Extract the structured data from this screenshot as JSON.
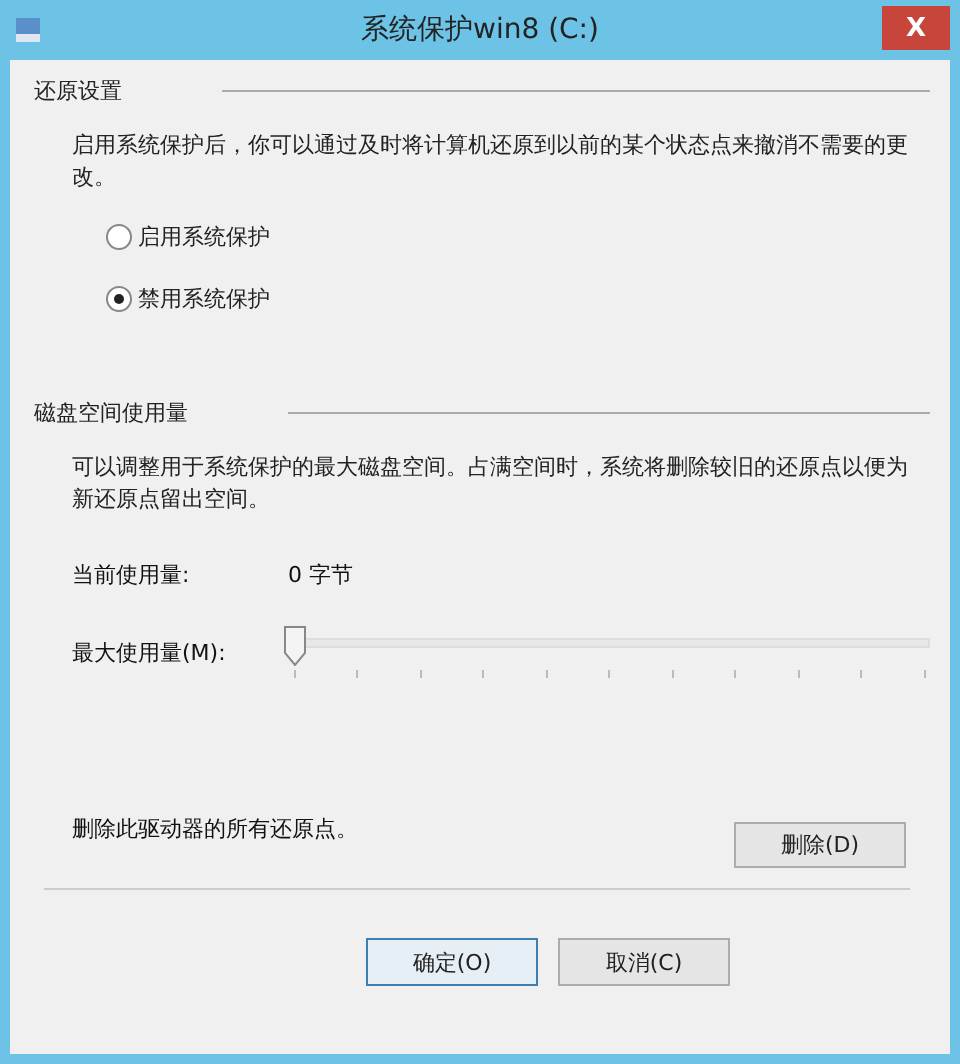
{
  "window": {
    "title": "系统保护win8 (C:)",
    "close_label": "X"
  },
  "restore_settings": {
    "heading": "还原设置",
    "description": "启用系统保护后，你可以通过及时将计算机还原到以前的某个状态点来撤消不需要的更改。",
    "options": [
      {
        "label": "启用系统保护",
        "selected": false
      },
      {
        "label": "禁用系统保护",
        "selected": true
      }
    ]
  },
  "disk_usage": {
    "heading": "磁盘空间使用量",
    "description": "可以调整用于系统保护的最大磁盘空间。占满空间时，系统将删除较旧的还原点以便为新还原点留出空间。",
    "current_label": "当前使用量:",
    "current_value": "0 字节",
    "max_label": "最大使用量(M):",
    "level": 0
  },
  "delete": {
    "text": "删除此驱动器的所有还原点。",
    "button": "删除(D)"
  },
  "buttons": [
    {
      "label": "确定(O)",
      "selected": true
    },
    {
      "label": "取消(C)",
      "selected": false
    }
  ]
}
